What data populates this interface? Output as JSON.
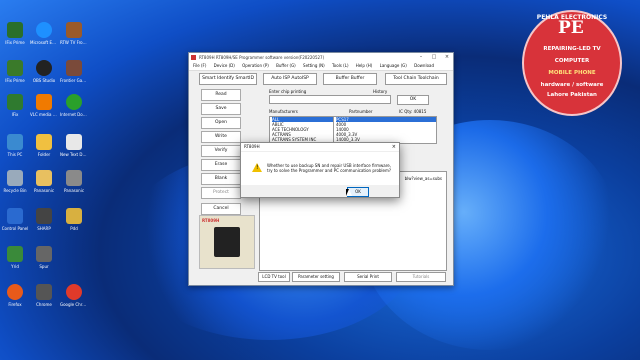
{
  "desktop_icons": [
    {
      "label": "IFix Prime",
      "x": "a"
    },
    {
      "label": "Microsoft Edge",
      "x": "b"
    },
    {
      "label": "RTW TV Frontier",
      "x": "c"
    },
    {
      "label": "IFix Prime",
      "x": "d"
    },
    {
      "label": "OBS Studio",
      "x": "e"
    },
    {
      "label": "Frontier Game",
      "x": "f"
    },
    {
      "label": "IFix",
      "x": "g"
    },
    {
      "label": "VLC media player",
      "x": "h"
    },
    {
      "label": "Internet Download",
      "x": "i"
    },
    {
      "label": "This PC",
      "x": "j"
    },
    {
      "label": "Folder",
      "x": "k"
    },
    {
      "label": "New Text Document",
      "x": "l"
    },
    {
      "label": "Recycle Bin",
      "x": "m"
    },
    {
      "label": "Panasonic",
      "x": "n"
    },
    {
      "label": "Panasonic",
      "x": "o"
    },
    {
      "label": "Control Panel",
      "x": "p"
    },
    {
      "label": "SHARP",
      "x": "q"
    },
    {
      "label": "Pdd",
      "x": "r"
    },
    {
      "label": "Yrid",
      "x": "s"
    },
    {
      "label": "Spur",
      "x": "t"
    },
    {
      "label": "Firefox",
      "x": "u"
    },
    {
      "label": "Chrome",
      "x": "v"
    },
    {
      "label": "Google Chrome",
      "x": "w"
    }
  ],
  "app": {
    "title": "RT809H RT809H/SE Programmer  software version(F20220527)",
    "menu": [
      "File (F)",
      "Device (D)",
      "Operation (P)",
      "Buffer (G)",
      "Setting (N)",
      "Tools (L)",
      "Help (H)",
      "Language (G)",
      "Download"
    ],
    "top_buttons": {
      "smart_id": "Smart Identify SmartID",
      "auto_isp": "Auto ISP AutoISP",
      "buffer": "Buffer Buffer",
      "toolchain": "Tool Chain Toolchain"
    },
    "side_buttons": [
      "Read",
      "Save",
      "Open",
      "Write",
      "Verify",
      "Erase",
      "Blank",
      "Protect",
      "Cancel"
    ],
    "search_label": "Enter chip printing",
    "history_label": "History",
    "ok_label": "OK",
    "manufacturers_label": "Manufacturers",
    "partnumber_label": "Partnumber",
    "ic_qty": "IC Qty: 40815",
    "manufacturers": [
      "ALL",
      "ABLIC",
      "ACE TECHNOLOGY",
      "ACTRANS",
      "ACTRANS SYSTEM INC"
    ],
    "partnumbers": [
      "PCS17",
      "4000",
      "14000",
      "4000_3.3V",
      "14000_3.3V"
    ],
    "log_fragment": "blw?view_as=subs",
    "bottom_buttons": [
      "LCD TV tool",
      "Parameter setting",
      "Serial Print",
      "Tutorials"
    ],
    "device_label": "RT809H"
  },
  "dialog": {
    "title": "RT809H",
    "message": "Whether to use backup SN and repair USB interface firmware, try to solve the Programmer and PC communication problem?",
    "ok": "OK",
    "close": "×"
  },
  "logo": {
    "ring": "PEHLA ELECTRONICS",
    "initials": "PE",
    "line1": "REPAIRING-LED TV",
    "line2": "COMPUTER",
    "line3": "MOBILE PHONE",
    "line4": "hardware / software",
    "line5": "Lahore Pakistan"
  }
}
